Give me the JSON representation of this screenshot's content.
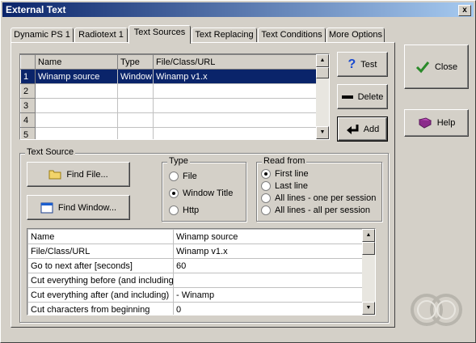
{
  "window": {
    "title": "External Text",
    "close_glyph": "x"
  },
  "tabs": [
    {
      "label": "Dynamic PS 1",
      "active": false
    },
    {
      "label": "Radiotext 1",
      "active": false
    },
    {
      "label": "Text Sources",
      "active": true
    },
    {
      "label": "Text Replacing",
      "active": false
    },
    {
      "label": "Text Conditions",
      "active": false
    },
    {
      "label": "More Options",
      "active": false
    }
  ],
  "sources_table": {
    "columns": [
      "Name",
      "Type",
      "File/Class/URL"
    ],
    "rows": [
      {
        "num": "1",
        "name": "Winamp source",
        "type": "Window",
        "url": "Winamp v1.x",
        "selected": true
      },
      {
        "num": "2",
        "name": "",
        "type": "",
        "url": "",
        "selected": false
      },
      {
        "num": "3",
        "name": "",
        "type": "",
        "url": "",
        "selected": false
      },
      {
        "num": "4",
        "name": "",
        "type": "",
        "url": "",
        "selected": false
      },
      {
        "num": "5",
        "name": "",
        "type": "",
        "url": "",
        "selected": false
      }
    ]
  },
  "side_buttons": {
    "test": "Test",
    "delete": "Delete",
    "add": "Add"
  },
  "right_buttons": {
    "close": "Close",
    "help": "Help"
  },
  "text_source": {
    "label": "Text Source",
    "find_file": "Find File...",
    "find_window": "Find Window...",
    "type_group": {
      "label": "Type",
      "options": [
        "File",
        "Window Title",
        "Http"
      ],
      "selected": "Window Title"
    },
    "read_group": {
      "label": "Read from",
      "options": [
        "First line",
        "Last line",
        "All lines - one per session",
        "All lines - all per session"
      ],
      "selected": "First line"
    }
  },
  "properties": [
    {
      "key": "Name",
      "value": "Winamp source"
    },
    {
      "key": "File/Class/URL",
      "value": "Winamp v1.x"
    },
    {
      "key": "Go to next after [seconds]",
      "value": "60"
    },
    {
      "key": "Cut everything before (and including)",
      "value": ""
    },
    {
      "key": "Cut everything after (and including)",
      "value": " - Winamp"
    },
    {
      "key": "Cut characters from beginning",
      "value": "0"
    }
  ],
  "colors": {
    "selection": "#0a246a",
    "face": "#d4d0c8",
    "ok_green": "#2a8a2a"
  }
}
